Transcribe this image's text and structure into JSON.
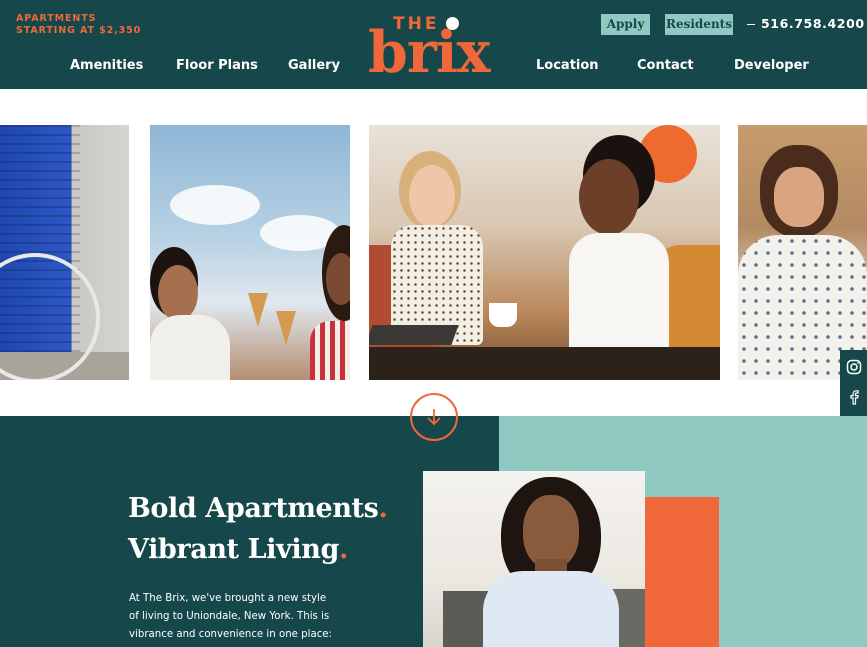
{
  "header": {
    "promo_line1": "APARTMENTS",
    "promo_line2": "STARTING AT $2,350",
    "logo_the": "THE",
    "logo_name": "brix",
    "apply_label": "Apply",
    "residents_label": "Residents",
    "phone": "516.758.4200",
    "nav": [
      "Amenities",
      "Floor Plans",
      "Gallery",
      "Location",
      "Contact",
      "Developer"
    ]
  },
  "gallery": {
    "photos": [
      "street-bike-photo",
      "ice-cream-friends-photo",
      "cafe-friends-photo",
      "laughing-man-photo"
    ]
  },
  "social": {
    "icons": [
      "instagram-icon",
      "facebook-icon"
    ]
  },
  "hero": {
    "headline_line1": "Bold Apartments",
    "headline_line2": "Vibrant Living",
    "headline_punct": ".",
    "body_line1": "At The Brix, we've brought a new style",
    "body_line2": "of living to Uniondale, New York. This is",
    "body_line3": "vibrance and convenience in one place:"
  },
  "colors": {
    "dark_teal": "#16474a",
    "light_teal": "#8fc9c1",
    "orange": "#f0683a",
    "white": "#ffffff"
  }
}
